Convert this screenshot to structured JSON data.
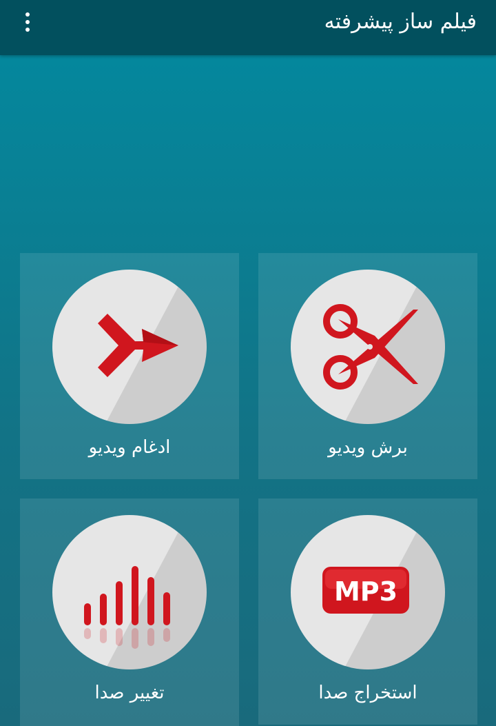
{
  "app": {
    "title": "فیلم ساز پیشرفته",
    "menu_icon": "overflow-menu-icon"
  },
  "colors": {
    "appbar": "#02505e",
    "background_top": "#028aa0",
    "background_bottom": "#196a7c",
    "icon_red": "#d0161e",
    "circle_light": "#e6e6e6",
    "circle_shade": "#cdcdcd"
  },
  "tiles": [
    {
      "id": "cut-video",
      "label": "برش ویدیو",
      "icon": "scissors-icon"
    },
    {
      "id": "merge-video",
      "label": "ادغام ویدیو",
      "icon": "merge-arrow-icon"
    },
    {
      "id": "extract-audio",
      "label": "استخراج صدا",
      "icon": "mp3-icon",
      "icon_text": "MP3"
    },
    {
      "id": "change-audio",
      "label": "تغییر صدا",
      "icon": "equalizer-icon"
    }
  ]
}
